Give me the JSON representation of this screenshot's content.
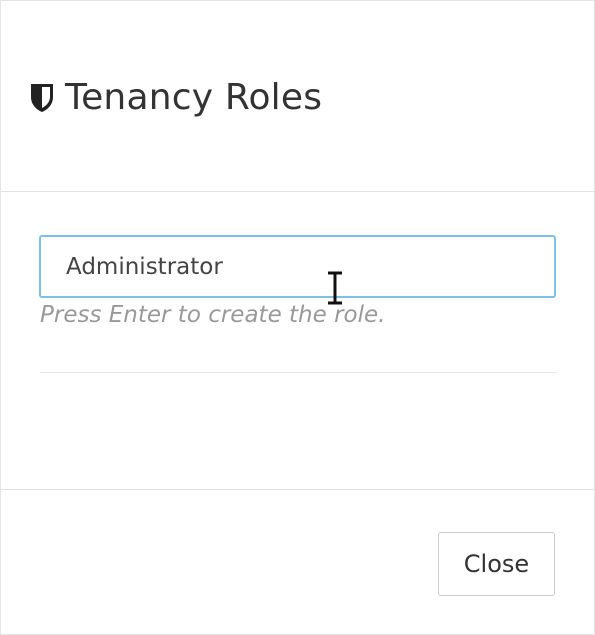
{
  "header": {
    "icon": "shield-icon",
    "title": "Tenancy Roles"
  },
  "role_form": {
    "input_value": "Administrator",
    "hint": "Press Enter to create the role."
  },
  "footer": {
    "close_label": "Close"
  }
}
